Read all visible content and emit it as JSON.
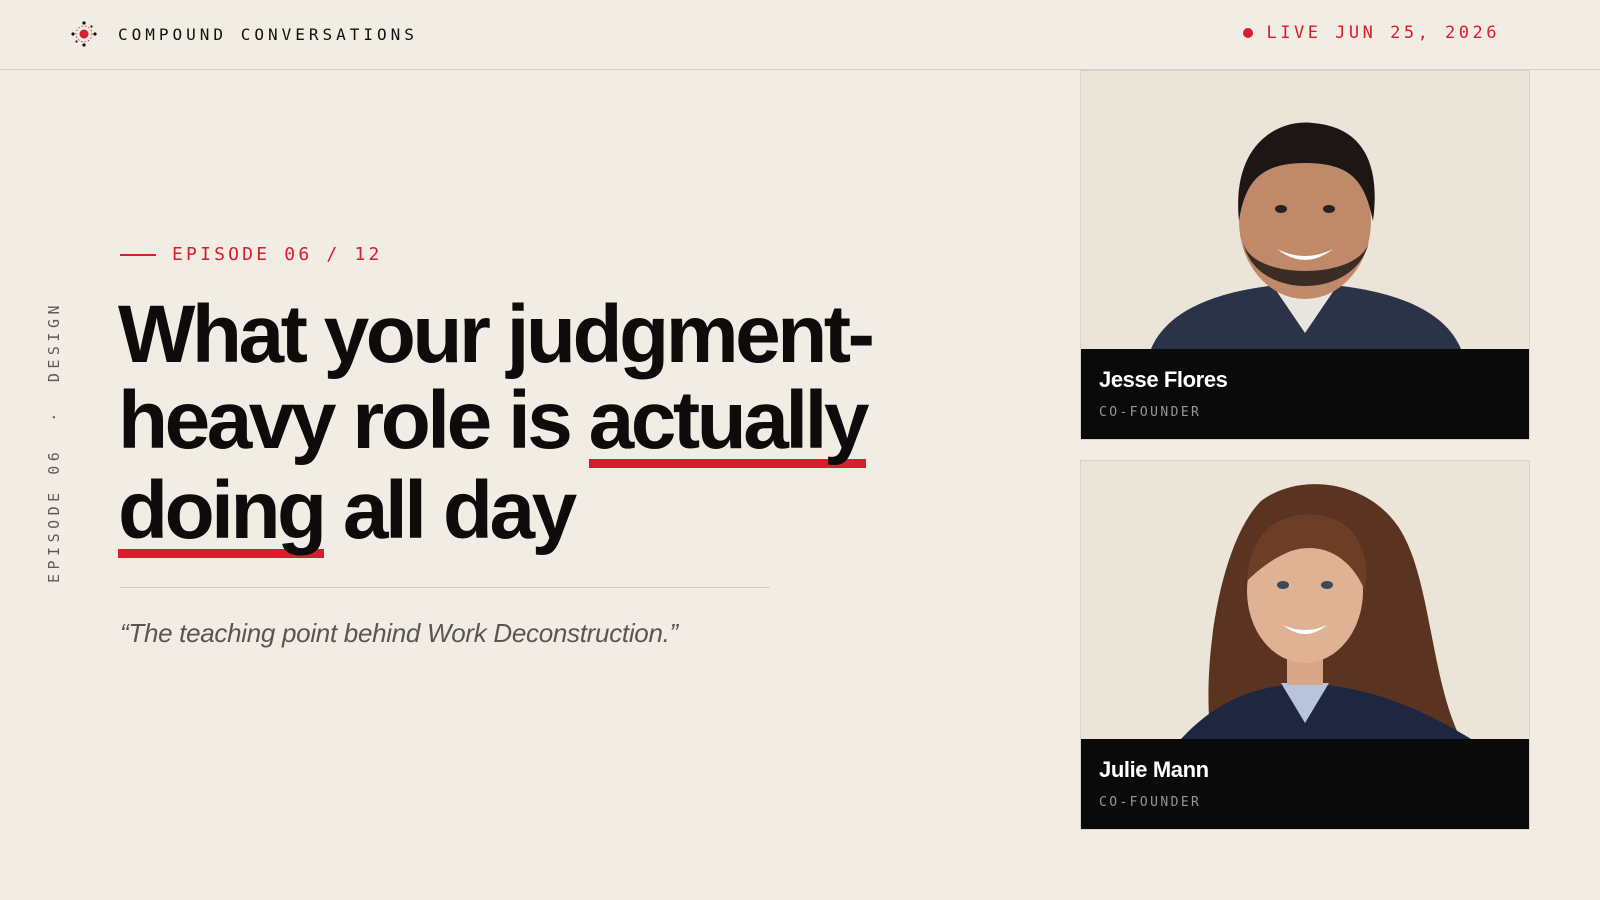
{
  "brand": {
    "name": "COMPOUND CONVERSATIONS",
    "logo_icon": "target-dots-icon"
  },
  "live": {
    "label": "LIVE JUN 25, 2026"
  },
  "side_label": {
    "episode": "EPISODE 06",
    "separator": "·",
    "category": "DESIGN"
  },
  "episode": {
    "label": "EPISODE 06 / 12"
  },
  "headline": {
    "line1": "What your judgment-",
    "line2_plain": "heavy role is ",
    "line2_underlined": "actually",
    "line3_underlined": "doing",
    "line3_plain": " all day"
  },
  "quote": "“The teaching point behind Work Deconstruction.”",
  "guests": [
    {
      "name": "Jesse Flores",
      "role": "CO-FOUNDER"
    },
    {
      "name": "Julie Mann",
      "role": "CO-FOUNDER"
    }
  ],
  "colors": {
    "accent": "#d81d2c",
    "background": "#f1ece4",
    "ink": "#0d0c0b",
    "card": "#0b0a0a"
  }
}
